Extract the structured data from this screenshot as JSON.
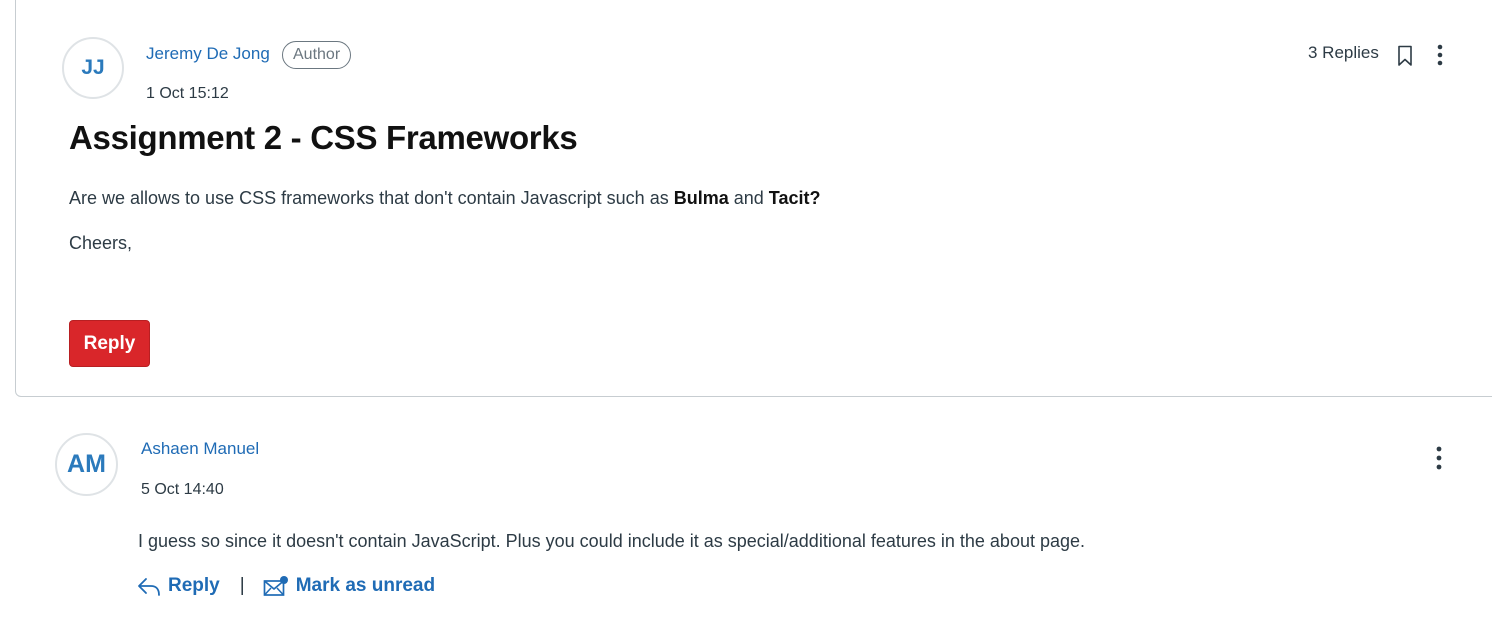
{
  "post": {
    "author": {
      "initials": "JJ",
      "name": "Jeremy De Jong",
      "badge": "Author"
    },
    "timestamp": "1 Oct 15:12",
    "replies_count": "3 Replies",
    "title": "Assignment 2 - CSS Frameworks",
    "body": {
      "text_before": "Are we allows to use CSS frameworks that don't contain Javascript such as ",
      "bold_1": "Bulma",
      "text_mid": " and ",
      "bold_2": "Tacit?"
    },
    "signoff": "Cheers,",
    "reply_button": "Reply",
    "icons": {
      "bookmark": "bookmark-icon",
      "menu": "kebab-menu-icon"
    }
  },
  "reply": {
    "author": {
      "initials": "AM",
      "name": "Ashaen Manuel"
    },
    "timestamp": "5 Oct 14:40",
    "text": "I guess so since it doesn't contain JavaScript. Plus you could include it as special/additional features in the about page.",
    "actions": {
      "reply_label": "Reply",
      "separator": "|",
      "mark_unread_label": "Mark as unread"
    },
    "icons": {
      "reply": "reply-arrow-icon",
      "mark_unread": "mail-unread-icon",
      "menu": "kebab-menu-icon"
    }
  },
  "colors": {
    "link": "#1f6bb5",
    "primary_button": "#d9262a",
    "text": "#2d3b45",
    "border": "#c7cdd1"
  }
}
